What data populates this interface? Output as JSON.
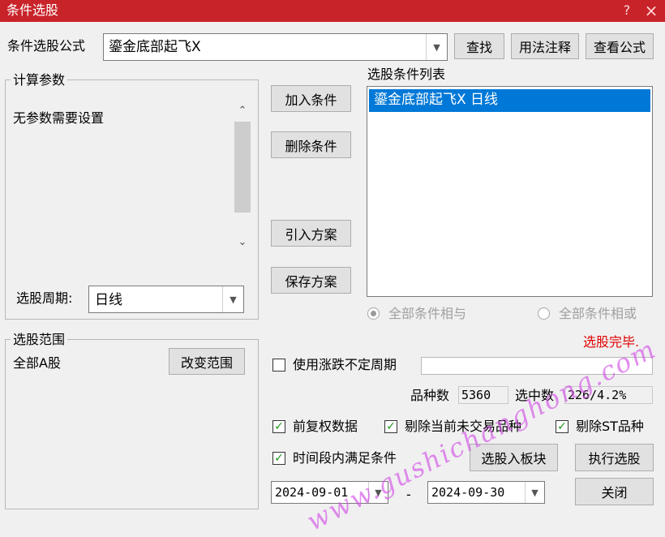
{
  "window": {
    "title": "条件选股",
    "controls": [
      "?",
      "×"
    ]
  },
  "formula_row": {
    "label": "条件选股公式",
    "formula_value": "鎏金底部起飞X",
    "find_button": "查找",
    "usage_button": "用法注释",
    "view_button": "查看公式"
  },
  "params_group": {
    "title": "计算参数",
    "message": "无参数需要设置",
    "period_label": "选股周期:",
    "period_value": "日线"
  },
  "middle_buttons": {
    "add_condition": "加入条件",
    "delete_condition": "删除条件",
    "import_plan": "引入方案",
    "save_plan": "保存方案"
  },
  "condition_list": {
    "title": "选股条件列表",
    "items": [
      "鎏金底部起飞X  日线"
    ],
    "radio_and": "全部条件相与",
    "radio_or": "全部条件相或"
  },
  "range_group": {
    "title": "选股范围",
    "value": "全部A股",
    "change_button": "改变范围"
  },
  "status": {
    "done_text": "选股完毕.",
    "done_color": "#e00000"
  },
  "options": {
    "use_variable_period": "使用涨跌不定周期",
    "variable_period_value": "",
    "variety_count_label": "品种数",
    "variety_count": "5360",
    "selected_count_label": "选中数",
    "selected_count": "226/4.2%",
    "pre_adjusted": "前复权数据",
    "exclude_non_trading": "剔除当前未交易品种",
    "exclude_st": "剔除ST品种",
    "time_period": "时间段内满足条件",
    "start_date": "2024-09-01",
    "date_separator": "-",
    "end_date": "2024-09-30"
  },
  "bottom_buttons": {
    "to_block": "选股入板块",
    "execute": "执行选股",
    "close": "关闭"
  },
  "watermark": "www.gushichanghong.com",
  "colors": {
    "title_bar": "#c9232a",
    "selection": "#0078d7",
    "check": "#1a9a1a",
    "watermark": "#d250e6"
  }
}
